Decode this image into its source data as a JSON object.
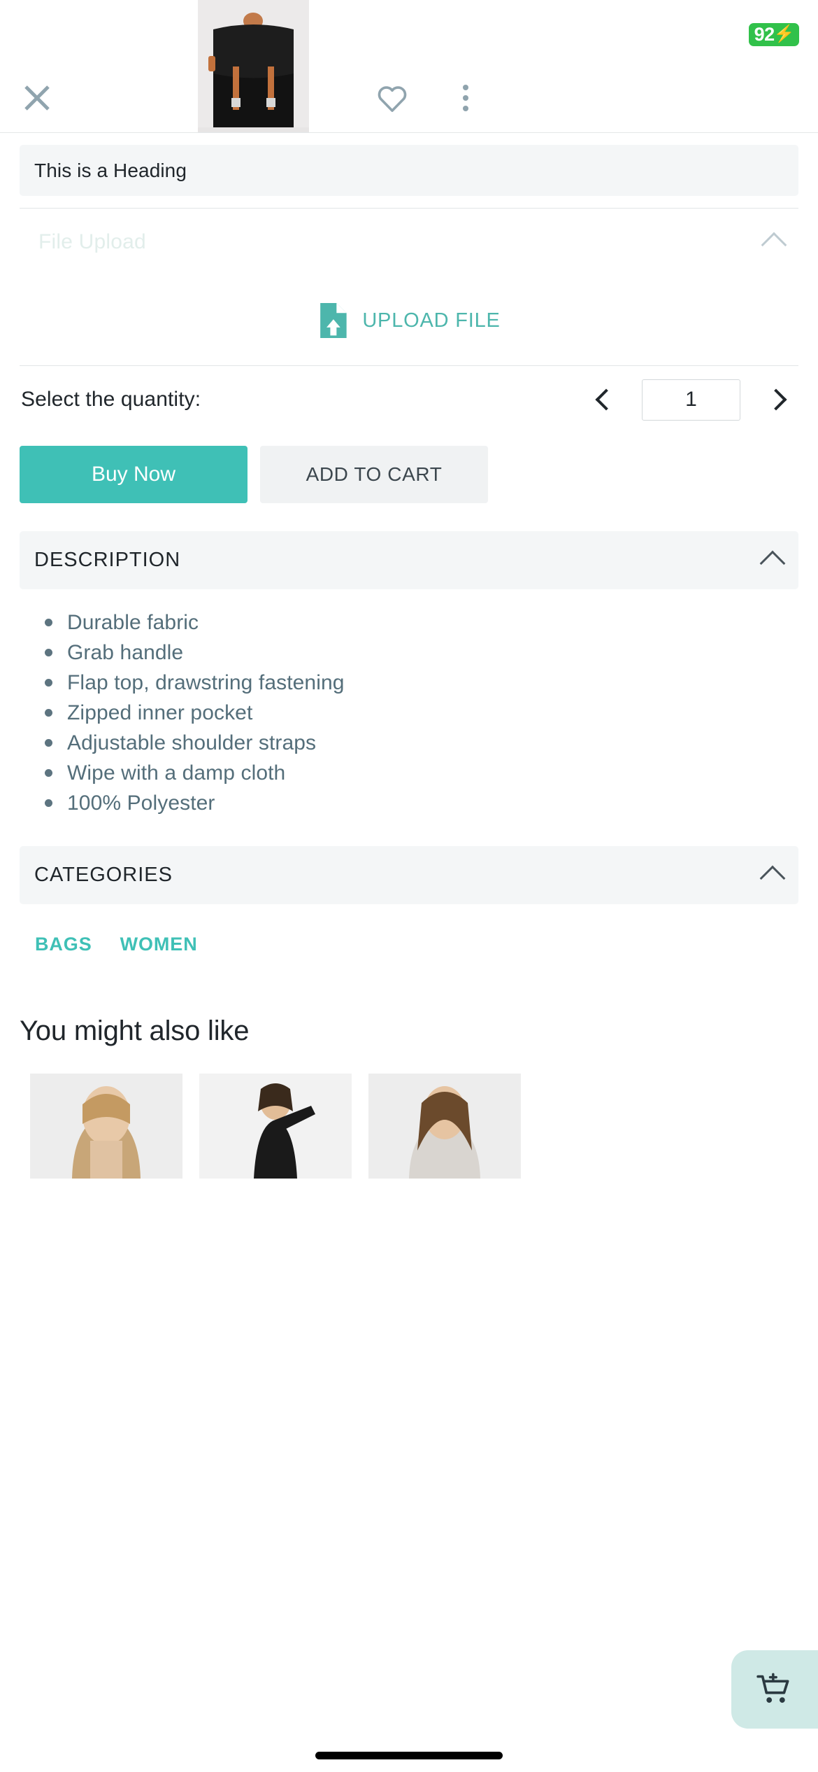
{
  "status": {
    "battery_level": "92",
    "battery_icon": "lightning-bolt",
    "battery_color": "#31c14a"
  },
  "header": {
    "close_icon": "close-icon",
    "favorite_icon": "heart-outline-icon",
    "overflow_icon": "three-dots-vertical-icon",
    "product_image_alt": "black canvas backpack with tan leather straps"
  },
  "heading_panel": {
    "text": "This is a Heading"
  },
  "file_upload": {
    "label": "File Upload",
    "collapse_icon": "chevron-up-icon",
    "button_label": "UPLOAD FILE",
    "button_icon": "file-upload-icon",
    "accent_color": "#4db6ac"
  },
  "quantity": {
    "label": "Select the quantity:",
    "decrement_icon": "chevron-left-icon",
    "increment_icon": "chevron-right-icon",
    "value": "1"
  },
  "actions": {
    "buy_label": "Buy Now",
    "cart_label": "ADD TO CART",
    "buy_color": "#3fc0b6"
  },
  "description": {
    "title": "DESCRIPTION",
    "collapse_icon": "chevron-up-icon",
    "items": [
      "Durable fabric",
      "Grab handle",
      "Flap top, drawstring fastening",
      "Zipped inner pocket",
      "Adjustable shoulder straps",
      "Wipe with a damp cloth",
      "100% Polyester"
    ]
  },
  "categories": {
    "title": "CATEGORIES",
    "collapse_icon": "chevron-up-icon",
    "tags": [
      "BAGS",
      "WOMEN"
    ]
  },
  "recommendations": {
    "title": "You might also like",
    "items": [
      {
        "alt": "blonde woman portrait"
      },
      {
        "alt": "woman in black dress"
      },
      {
        "alt": "woman with long brown hair"
      }
    ]
  },
  "fab": {
    "icon": "add-to-cart-icon",
    "color": "#cfe9e6"
  }
}
